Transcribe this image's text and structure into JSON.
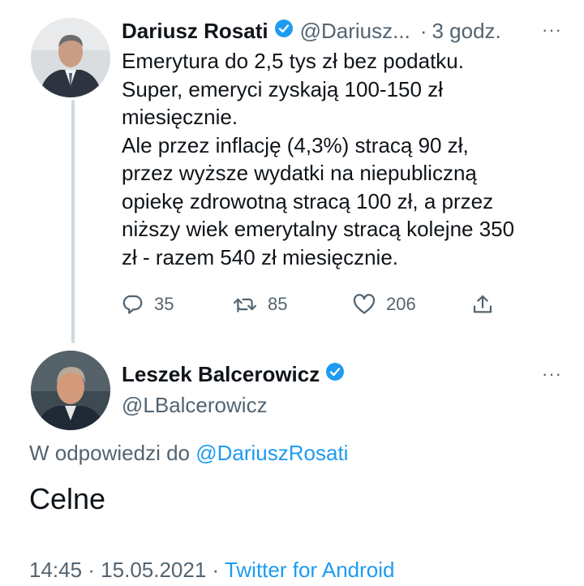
{
  "tweet1": {
    "author_name": "Dariusz Rosati",
    "handle": "@Dariusz...",
    "separator": "·",
    "time": "3 godz.",
    "text_lines": [
      "Emerytura do 2,5 tys zł bez podatku.",
      "Super, emeryci zyskają 100-150 zł",
      "miesięcznie.",
      "Ale przez inflację (4,3%) stracą 90 zł,",
      "przez wyższe wydatki na niepubliczną",
      "opiekę zdrowotną stracą 100 zł, a przez",
      "niższy wiek emerytalny stracą kolejne 350",
      "zł - razem 540 zł miesięcznie."
    ],
    "replies": "35",
    "retweets": "85",
    "likes": "206",
    "more": "···"
  },
  "tweet2": {
    "author_name": "Leszek Balcerowicz",
    "handle": "@LBalcerowicz",
    "more": "···",
    "reply_prefix": "W odpowiedzi do",
    "reply_mention": "@DariuszRosati",
    "text": "Celne",
    "timestamp": "14:45 · 15.05.2021 ·",
    "source": "Twitter for Android"
  },
  "icons": {
    "verified": "verified-badge-icon",
    "reply": "reply-icon",
    "retweet": "retweet-icon",
    "like": "like-icon",
    "share": "share-icon"
  },
  "colors": {
    "accent": "#1d9bf0",
    "text": "#0f1419",
    "secondary": "#536471",
    "thread_line": "#cfd9de"
  }
}
